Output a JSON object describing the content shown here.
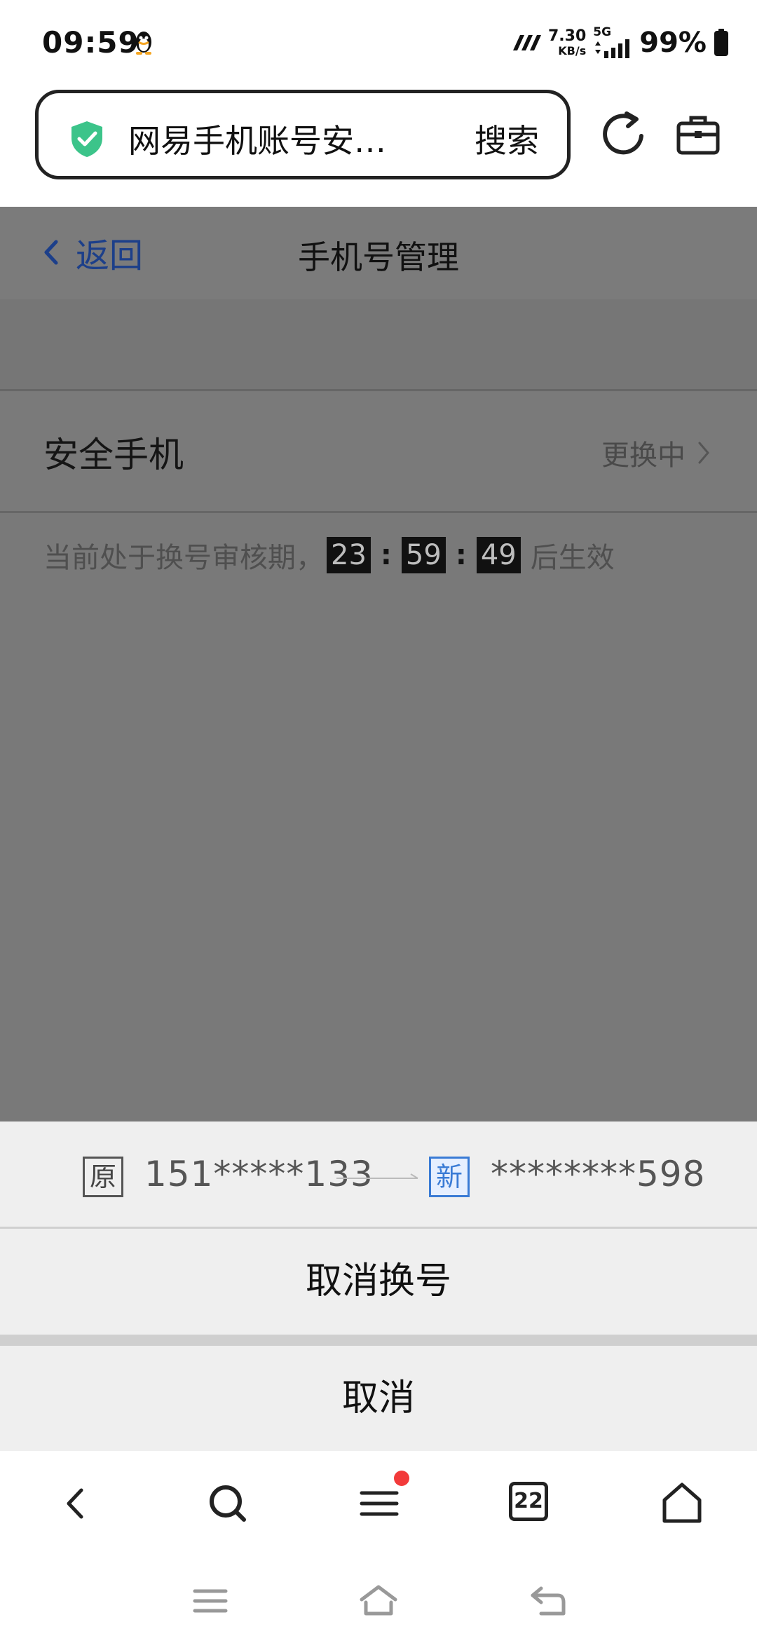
{
  "status_bar": {
    "time": "09:59",
    "network_speed_value": "7.30",
    "network_speed_unit": "KB/s",
    "network_type": "5G",
    "battery": "99%"
  },
  "browser": {
    "url_title": "网易手机账号安…",
    "search_label": "搜索",
    "tab_count": "22"
  },
  "page": {
    "back_label": "返回",
    "title": "手机号管理",
    "secure_phone_label": "安全手机",
    "secure_phone_status": "更换中",
    "notice_prefix": "当前处于换号审核期，",
    "timer": {
      "hours": "23",
      "minutes": "59",
      "seconds": "49"
    },
    "notice_suffix": "后生效"
  },
  "sheet": {
    "old_tag": "原",
    "old_number": "151*****133",
    "new_tag": "新",
    "new_number": "********598",
    "cancel_change_label": "取消换号",
    "cancel_label": "取消"
  },
  "colors": {
    "overlay": "#797979",
    "link_blue": "#1c3f8a",
    "shield_green": "#3cc48a",
    "new_tag_blue": "#3a7bd5",
    "notification_red": "#f23a3a"
  },
  "icons": [
    "qq-icon",
    "signal-icon",
    "battery-icon",
    "shield-check-icon",
    "refresh-icon",
    "toolbox-icon",
    "back-arrow-icon",
    "search-icon",
    "menu-icon",
    "tabs-icon",
    "home-icon"
  ]
}
